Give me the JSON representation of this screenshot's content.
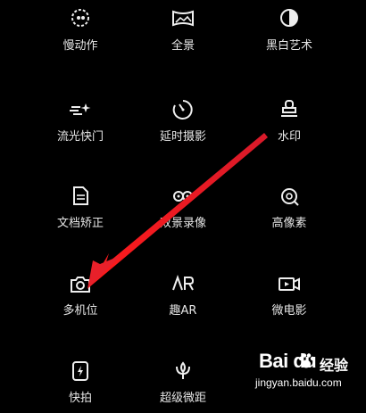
{
  "modes": [
    {
      "label": "慢动作",
      "icon": "slow-motion-icon"
    },
    {
      "label": "全景",
      "icon": "panorama-icon"
    },
    {
      "label": "黑白艺术",
      "icon": "monochrome-icon"
    },
    {
      "label": "流光快门",
      "icon": "light-painting-icon"
    },
    {
      "label": "延时摄影",
      "icon": "time-lapse-icon"
    },
    {
      "label": "水印",
      "icon": "watermark-stamp-icon"
    },
    {
      "label": "文档矫正",
      "icon": "document-icon"
    },
    {
      "label": "双景录像",
      "icon": "dual-view-icon"
    },
    {
      "label": "高像素",
      "icon": "high-resolution-icon"
    },
    {
      "label": "多机位",
      "icon": "multi-camera-icon"
    },
    {
      "label": "趣AR",
      "icon": "ar-icon"
    },
    {
      "label": "微电影",
      "icon": "micro-movie-icon"
    },
    {
      "label": "快拍",
      "icon": "quick-snap-icon"
    },
    {
      "label": "超级微距",
      "icon": "super-macro-icon"
    }
  ],
  "watermark": {
    "logo": "Bai du",
    "text": "经验",
    "url": "jingyan.baidu.com"
  },
  "colors": {
    "background": "#000000",
    "text": "#e6e6e6",
    "arrow": "#e8202a"
  }
}
